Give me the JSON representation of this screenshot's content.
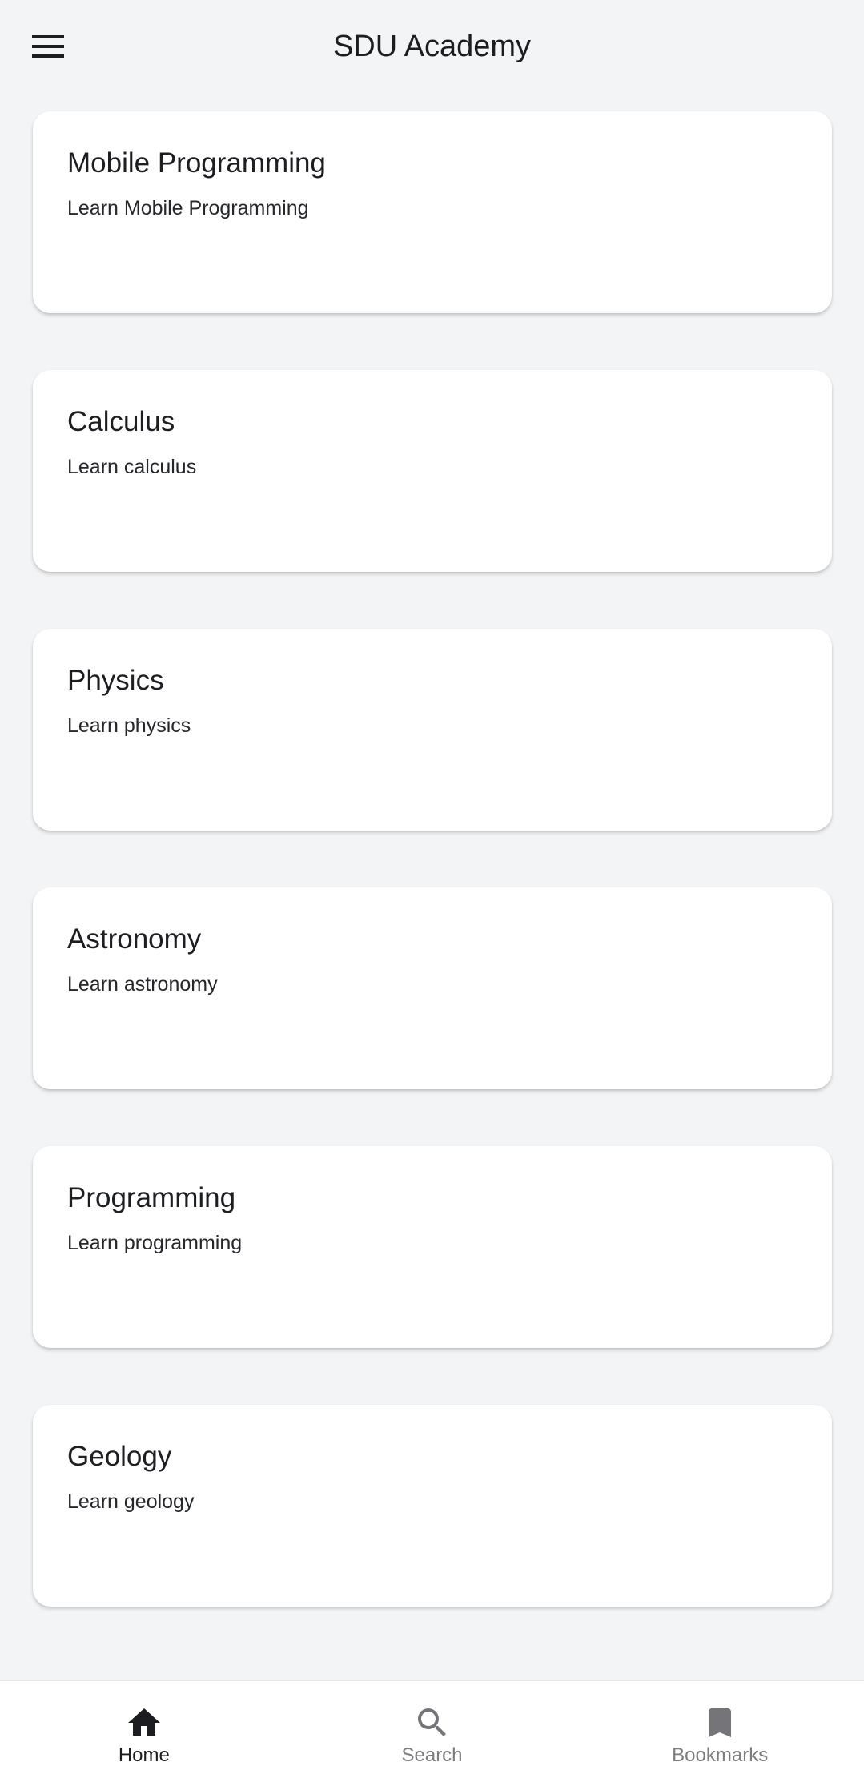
{
  "app_bar": {
    "title": "SDU Academy",
    "menu_icon": "hamburger-menu-icon"
  },
  "courses": [
    {
      "title": "Mobile Programming",
      "description": "Learn Mobile Programming"
    },
    {
      "title": "Calculus",
      "description": "Learn calculus"
    },
    {
      "title": "Physics",
      "description": "Learn physics"
    },
    {
      "title": "Astronomy",
      "description": "Learn astronomy"
    },
    {
      "title": "Programming",
      "description": "Learn programming"
    },
    {
      "title": "Geology",
      "description": "Learn geology"
    }
  ],
  "bottom_nav": {
    "items": [
      {
        "label": "Home",
        "icon": "home-icon",
        "active": true
      },
      {
        "label": "Search",
        "icon": "search-icon",
        "active": false
      },
      {
        "label": "Bookmarks",
        "icon": "bookmark-icon",
        "active": false
      }
    ],
    "colors": {
      "active": "#1b1d20",
      "inactive": "#7a7c80"
    }
  }
}
